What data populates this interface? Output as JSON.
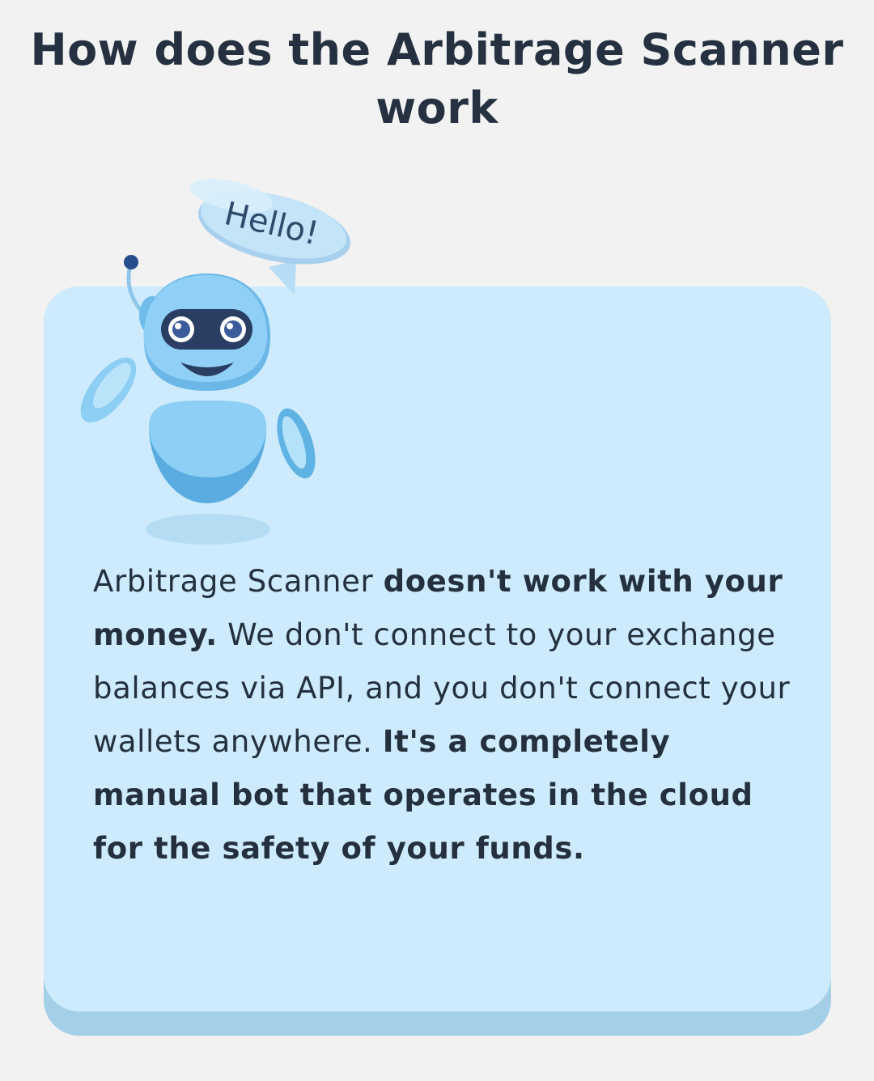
{
  "page": {
    "title": "How does the Arbitrage Scanner work"
  },
  "illustration": {
    "speech_bubble": "Hello!",
    "icon": "robot-mascot-icon"
  },
  "card": {
    "text_1": "Arbitrage Scanner ",
    "text_2_bold": "doesn't work with your money.",
    "text_3": " We don't connect to your exchange balances via API, and you don't connect your wallets anywhere. ",
    "text_4_bold": "It's a completely manual bot that operates in the cloud for the safety of your funds."
  },
  "colors": {
    "background": "#f2f2f2",
    "card": "#cdebfc",
    "card_shadow": "#a3cfe7",
    "robot": "#8fd0f5",
    "text": "#24303d"
  }
}
